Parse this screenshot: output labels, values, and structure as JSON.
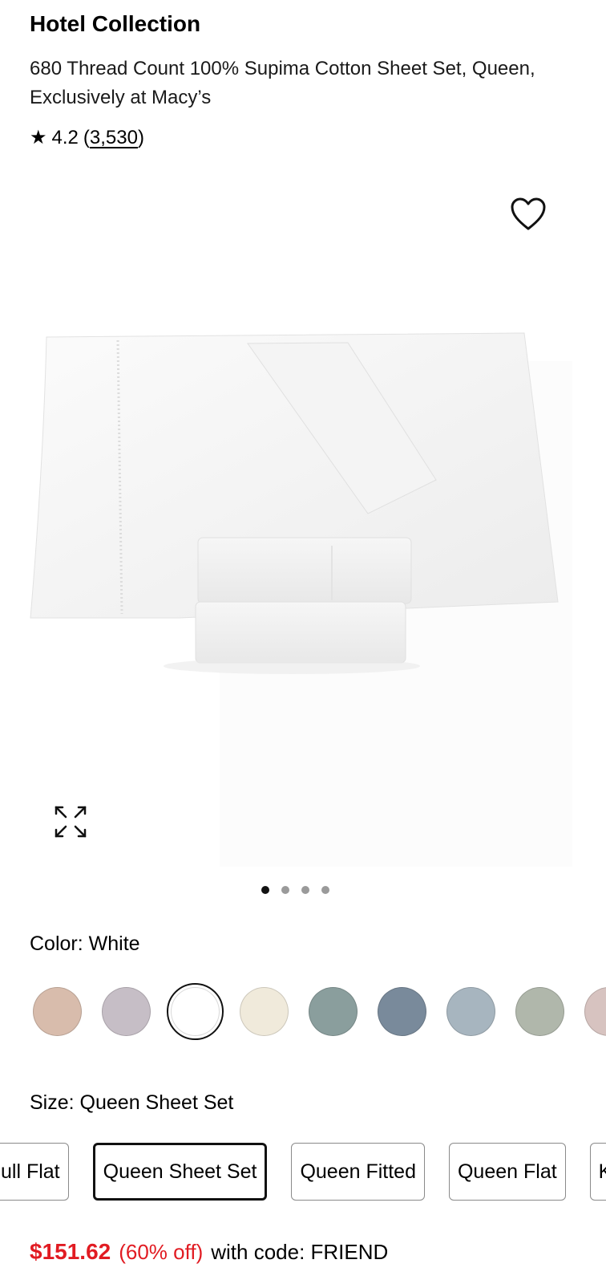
{
  "product": {
    "brand": "Hotel Collection",
    "title": "680 Thread Count 100% Supima Cotton Sheet Set, Queen, Exclusively at Macy’s",
    "rating_star": "★",
    "rating": "4.2",
    "review_count": "3,530",
    "paren_open": "(",
    "paren_close": ")"
  },
  "icons": {
    "favorite": "heart-outline-icon",
    "expand": "expand-icon"
  },
  "gallery": {
    "image_count": 4,
    "active_index": 0
  },
  "color": {
    "label": "Color:",
    "selected": "White",
    "swatches": [
      {
        "name": "Blush",
        "hex": "#d8bcac"
      },
      {
        "name": "Lilac",
        "hex": "#c6bec6"
      },
      {
        "name": "White",
        "hex": "#ffffff",
        "selected": true
      },
      {
        "name": "Ivory",
        "hex": "#f0eadb"
      },
      {
        "name": "Sage",
        "hex": "#8a9e9d"
      },
      {
        "name": "Slate",
        "hex": "#798a9b"
      },
      {
        "name": "Mist",
        "hex": "#a7b5bf"
      },
      {
        "name": "Celadon",
        "hex": "#b0b7ab"
      },
      {
        "name": "Rose",
        "hex": "#d7c3c0"
      }
    ]
  },
  "size": {
    "label": "Size:",
    "selected": "Queen Sheet Set",
    "options": [
      "ull Flat",
      "Queen Sheet Set",
      "Queen Fitted",
      "Queen Flat",
      "K"
    ]
  },
  "price": {
    "amount": "$151.62",
    "discount": "(60% off)",
    "code_text": "with code: FRIEND"
  },
  "colors": {
    "sale_red": "#e11b22"
  }
}
